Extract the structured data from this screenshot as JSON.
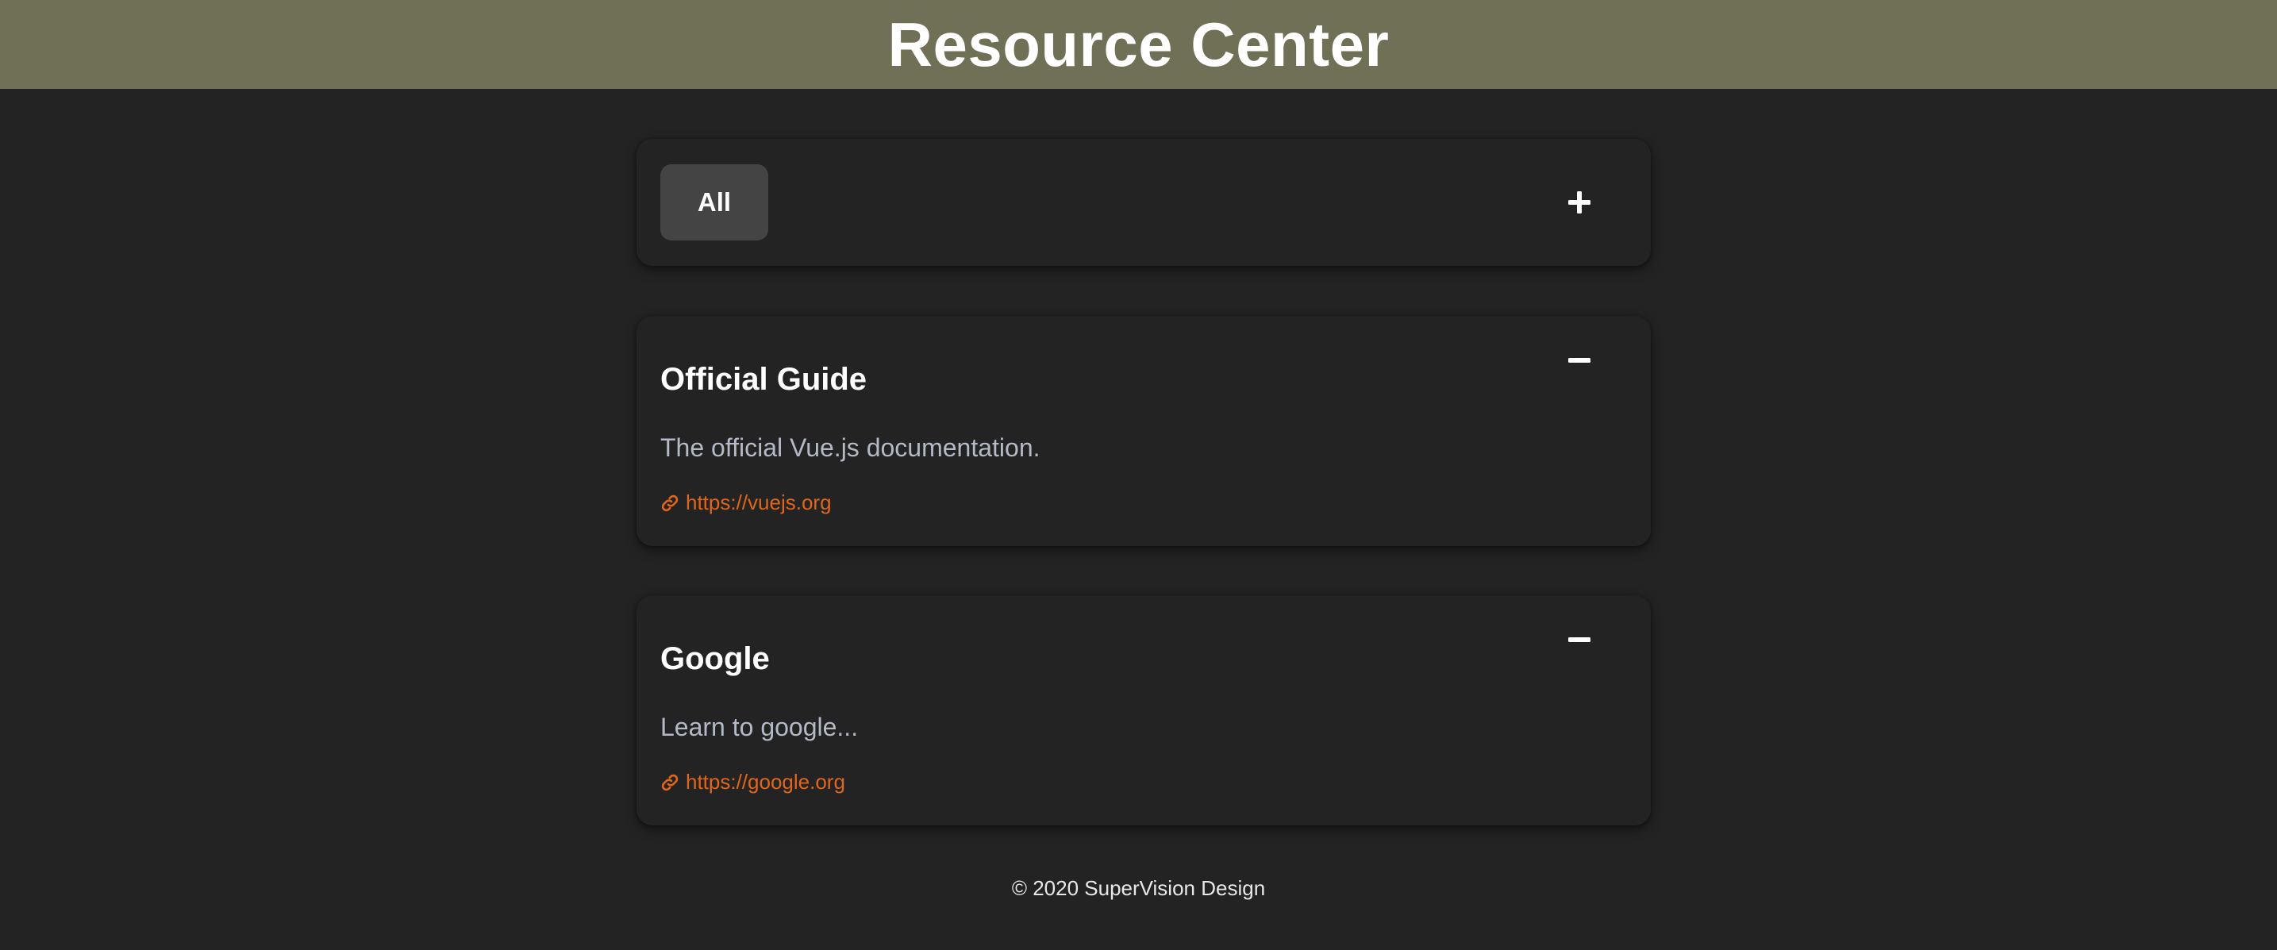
{
  "header": {
    "title": "Resource Center"
  },
  "toolbar": {
    "filter_all_label": "All",
    "add_icon": "plus-icon"
  },
  "resources": [
    {
      "title": "Official Guide",
      "description": "The official Vue.js documentation.",
      "link": "https://vuejs.org",
      "link_icon": "link-icon",
      "toggle_icon": "minus-icon"
    },
    {
      "title": "Google",
      "description": "Learn to google...",
      "link": "https://google.org",
      "link_icon": "link-icon",
      "toggle_icon": "minus-icon"
    }
  ],
  "footer": {
    "text": "© 2020 SuperVision Design"
  },
  "colors": {
    "header_bg": "#6f7056",
    "page_bg": "#232323",
    "button_bg": "#444444",
    "link": "#e0661d",
    "description": "#b3bac6"
  }
}
